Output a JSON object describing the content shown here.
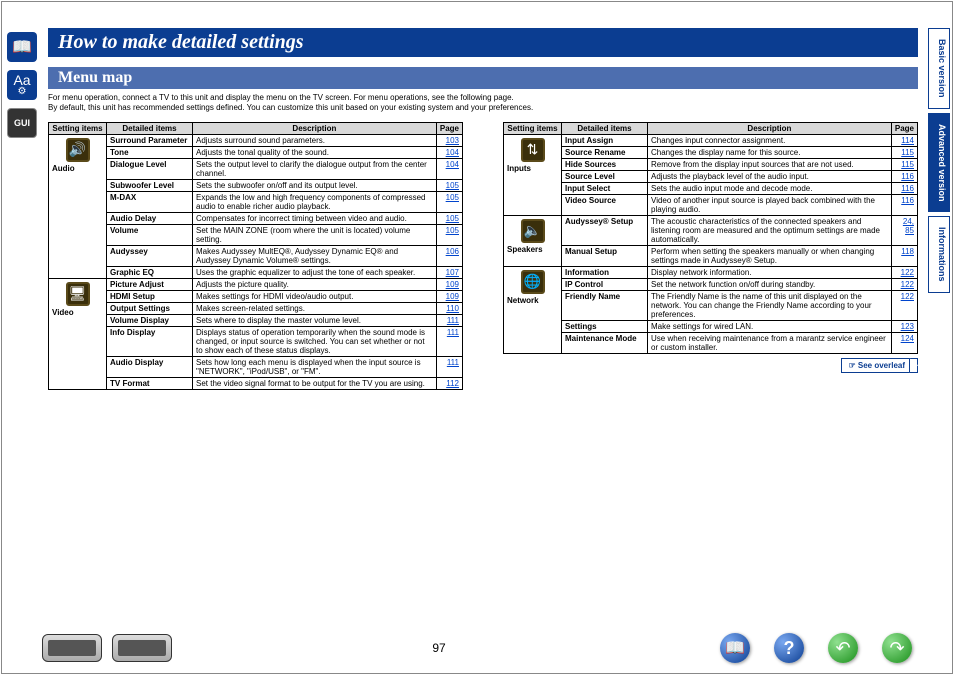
{
  "title": "How to make detailed settings",
  "subtitle": "Menu map",
  "intro_line1": "For menu operation, connect a TV to this unit and display the menu on the TV screen. For menu operations, see the following page.",
  "intro_line2": "By default, this unit has recommended settings defined. You can customize this unit based on your existing system and your preferences.",
  "columns": {
    "setting": "Setting items",
    "detail": "Detailed items",
    "desc": "Description",
    "page": "Page"
  },
  "categories_left": [
    {
      "name": "Audio",
      "rows": [
        {
          "detail": "Surround Parameter",
          "desc": "Adjusts surround sound parameters.",
          "page": "103"
        },
        {
          "detail": "Tone",
          "desc": "Adjusts the tonal quality of the sound.",
          "page": "104"
        },
        {
          "detail": "Dialogue Level",
          "desc": "Sets the output level to clarify the dialogue output from the center channel.",
          "page": "104"
        },
        {
          "detail": "Subwoofer Level",
          "desc": "Sets the subwoofer on/off and its output level.",
          "page": "105"
        },
        {
          "detail": "M-DAX",
          "desc": "Expands the low and high frequency components of compressed audio to enable richer audio playback.",
          "page": "105"
        },
        {
          "detail": "Audio Delay",
          "desc": "Compensates for incorrect timing between video and audio.",
          "page": "105"
        },
        {
          "detail": "Volume",
          "desc": "Set the MAIN ZONE (room where the unit is located) volume setting.",
          "page": "105"
        },
        {
          "detail": "Audyssey",
          "desc": "Makes Audyssey MultEQ®, Audyssey Dynamic EQ® and Audyssey Dynamic Volume® settings.",
          "page": "106"
        },
        {
          "detail": "Graphic EQ",
          "desc": "Uses the graphic equalizer to adjust the tone of each speaker.",
          "page": "107"
        }
      ]
    },
    {
      "name": "Video",
      "rows": [
        {
          "detail": "Picture Adjust",
          "desc": "Adjusts the picture quality.",
          "page": "109"
        },
        {
          "detail": "HDMI Setup",
          "desc": "Makes settings for HDMI video/audio output.",
          "page": "109"
        },
        {
          "detail": "Output Settings",
          "desc": "Makes screen-related settings.",
          "page": "110"
        },
        {
          "detail": "Volume Display",
          "desc": "Sets where to display the master volume level.",
          "page": "111"
        },
        {
          "detail": "Info Display",
          "desc": "Displays status of operation temporarily when the sound mode is changed, or input source is switched. You can set whether or not to show each of these status displays.",
          "page": "111"
        },
        {
          "detail": "Audio Display",
          "desc": "Sets how long each menu is displayed when the input source is \"NETWORK\", \"iPod/USB\", or \"FM\".",
          "page": "111"
        },
        {
          "detail": "TV Format",
          "desc": "Set the video signal format to be output for the TV you are using.",
          "page": "112"
        }
      ]
    }
  ],
  "categories_right": [
    {
      "name": "Inputs",
      "rows": [
        {
          "detail": "Input Assign",
          "desc": "Changes input connector assignment.",
          "page": "114"
        },
        {
          "detail": "Source Rename",
          "desc": "Changes the display name for this source.",
          "page": "115"
        },
        {
          "detail": "Hide Sources",
          "desc": "Remove from the display input sources that are not used.",
          "page": "115"
        },
        {
          "detail": "Source Level",
          "desc": "Adjusts the playback level of the audio input.",
          "page": "116"
        },
        {
          "detail": "Input Select",
          "desc": "Sets the audio input mode and decode mode.",
          "page": "116"
        },
        {
          "detail": "Video Source",
          "desc": "Video of another input source is played back combined with the playing audio.",
          "page": "116"
        }
      ]
    },
    {
      "name": "Speakers",
      "rows": [
        {
          "detail": "Audyssey® Setup",
          "desc": "The acoustic characteristics of the connected speakers and listening room are measured and the optimum settings are made automatically.",
          "page": "24, 85"
        },
        {
          "detail": "Manual Setup",
          "desc": "Perform when setting the speakers manually or when changing settings made in Audyssey® Setup.",
          "page": "118"
        }
      ]
    },
    {
      "name": "Network",
      "rows": [
        {
          "detail": "Information",
          "desc": "Display network information.",
          "page": "122"
        },
        {
          "detail": "IP Control",
          "desc": "Set the network function on/off during standby.",
          "page": "122"
        },
        {
          "detail": "Friendly Name",
          "desc": "The Friendly Name is the name of this unit displayed on the network. You can change the Friendly Name according to your preferences.",
          "page": "122"
        },
        {
          "detail": "Settings",
          "desc": "Make settings for wired LAN.",
          "page": "123"
        },
        {
          "detail": "Maintenance Mode",
          "desc": "Use when receiving maintenance from a marantz service engineer or custom installer.",
          "page": "124"
        }
      ]
    }
  ],
  "see_overleaf": "See overleaf",
  "side_tabs": {
    "basic": "Basic version",
    "advanced": "Advanced version",
    "info": "Informations"
  },
  "rail_gui": "GUI",
  "page_number": "97"
}
